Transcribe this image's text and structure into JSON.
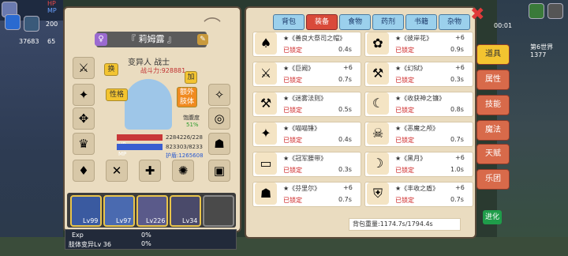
{
  "hud": {
    "hp_label": "HP",
    "mp_label": "MP",
    "level": "200",
    "gold": "37683",
    "gems": "65"
  },
  "character": {
    "name": "『 莉姆露 』",
    "class": "变异人 战士",
    "power": "战斗力:928881",
    "btn_swap": "换",
    "btn_personality": "性格",
    "btn_plus": "加",
    "btn_extra": "额外肢体",
    "satiety_label": "饱腹度",
    "satiety_value": "51%",
    "hp_label": "HP",
    "mp_label": "MP",
    "hp_value": "2284226/228",
    "mp_value": "823303/8233",
    "armor_value": "护盾:1265608",
    "skills": [
      {
        "label": "Lv99"
      },
      {
        "label": "Lv97"
      },
      {
        "label": "Lv226"
      },
      {
        "label": "Lv34"
      },
      {
        "label": ""
      }
    ],
    "exp_label": "Exp",
    "exp_value": "0%",
    "limb_label": "肢体变异Lv 36",
    "limb_value": "0%"
  },
  "inventory": {
    "tabs": [
      {
        "label": "背包"
      },
      {
        "label": "装备"
      },
      {
        "label": "食物"
      },
      {
        "label": "药剂"
      },
      {
        "label": "书籍"
      },
      {
        "label": "杂物"
      }
    ],
    "active_tab": "装备",
    "items": [
      {
        "name": "★《善良大祭司之帽》",
        "plus": "",
        "lock": "已锁定",
        "val": "0.4s",
        "icon": "hat-icon"
      },
      {
        "name": "★《彼岸花》",
        "plus": "+6",
        "lock": "已锁定",
        "val": "0.9s",
        "icon": "flower-icon"
      },
      {
        "name": "★《巨阙》",
        "plus": "+6",
        "lock": "已锁定",
        "val": "0.7s",
        "icon": "sword-icon"
      },
      {
        "name": "★《幻狱》",
        "plus": "+6",
        "lock": "已锁定",
        "val": "0.3s",
        "icon": "hammer-icon"
      },
      {
        "name": "★《迷雾法则》",
        "plus": "",
        "lock": "已锁定",
        "val": "0.5s",
        "icon": "axe-icon"
      },
      {
        "name": "★《收获神之镰》",
        "plus": "",
        "lock": "已锁定",
        "val": "0.8s",
        "icon": "scythe-icon"
      },
      {
        "name": "★《喵喵锤》",
        "plus": "",
        "lock": "已锁定",
        "val": "0.4s",
        "icon": "mace-icon"
      },
      {
        "name": "★《恶魔之颅》",
        "plus": "",
        "lock": "已锁定",
        "val": "0.7s",
        "icon": "skull-icon"
      },
      {
        "name": "★《冠军腰带》",
        "plus": "",
        "lock": "已锁定",
        "val": "0.3s",
        "icon": "belt-icon"
      },
      {
        "name": "★《黑月》",
        "plus": "+6",
        "lock": "已锁定",
        "val": "1.0s",
        "icon": "moon-icon"
      },
      {
        "name": "★《芬里尔》",
        "plus": "+6",
        "lock": "已锁定",
        "val": "0.7s",
        "icon": "wolf-icon"
      },
      {
        "name": "★《丰收之盾》",
        "plus": "+6",
        "lock": "已锁定",
        "val": "0.7s",
        "icon": "shield-icon"
      }
    ],
    "weight": "背包重量:1174.7s/1794.4s"
  },
  "sidenav": {
    "items": [
      {
        "label": "道具"
      },
      {
        "label": "属性"
      },
      {
        "label": "技能"
      },
      {
        "label": "魔法"
      },
      {
        "label": "天赋"
      },
      {
        "label": "乐团"
      }
    ],
    "evolve": "进化"
  },
  "right_hud": {
    "time": "00:01",
    "world": "第6世界1377"
  }
}
